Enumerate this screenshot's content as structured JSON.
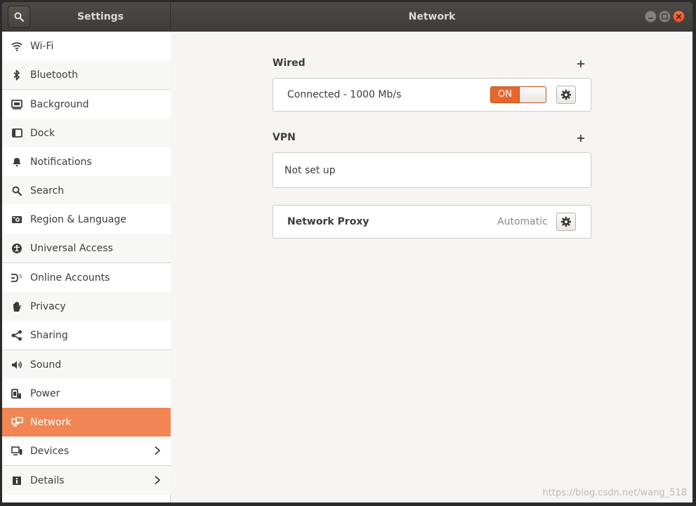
{
  "header": {
    "sidebar_title": "Settings",
    "main_title": "Network"
  },
  "sidebar": {
    "items": [
      {
        "label": "Wi-Fi",
        "icon": "wifi-icon"
      },
      {
        "label": "Bluetooth",
        "icon": "bluetooth-icon"
      },
      {
        "label": "Background",
        "icon": "background-icon"
      },
      {
        "label": "Dock",
        "icon": "dock-icon"
      },
      {
        "label": "Notifications",
        "icon": "bell-icon"
      },
      {
        "label": "Search",
        "icon": "search-icon"
      },
      {
        "label": "Region & Language",
        "icon": "camera-icon"
      },
      {
        "label": "Universal Access",
        "icon": "accessibility-icon"
      },
      {
        "label": "Online Accounts",
        "icon": "online-accounts-icon"
      },
      {
        "label": "Privacy",
        "icon": "hand-icon"
      },
      {
        "label": "Sharing",
        "icon": "share-icon"
      },
      {
        "label": "Sound",
        "icon": "speaker-icon"
      },
      {
        "label": "Power",
        "icon": "power-plug-icon"
      },
      {
        "label": "Network",
        "icon": "network-icon",
        "active": true
      },
      {
        "label": "Devices",
        "icon": "devices-icon",
        "chevron": true
      },
      {
        "label": "Details",
        "icon": "details-icon",
        "chevron": true
      }
    ]
  },
  "wired": {
    "title": "Wired",
    "status": "Connected - 1000 Mb/s",
    "switch_label": "ON"
  },
  "vpn": {
    "title": "VPN",
    "status": "Not set up"
  },
  "proxy": {
    "label": "Network Proxy",
    "value": "Automatic"
  },
  "watermark": "https://blog.csdn.net/wang_518",
  "colors": {
    "accent": "#f18654",
    "switch_on": "#e9652c",
    "header": "#3e3d39"
  }
}
